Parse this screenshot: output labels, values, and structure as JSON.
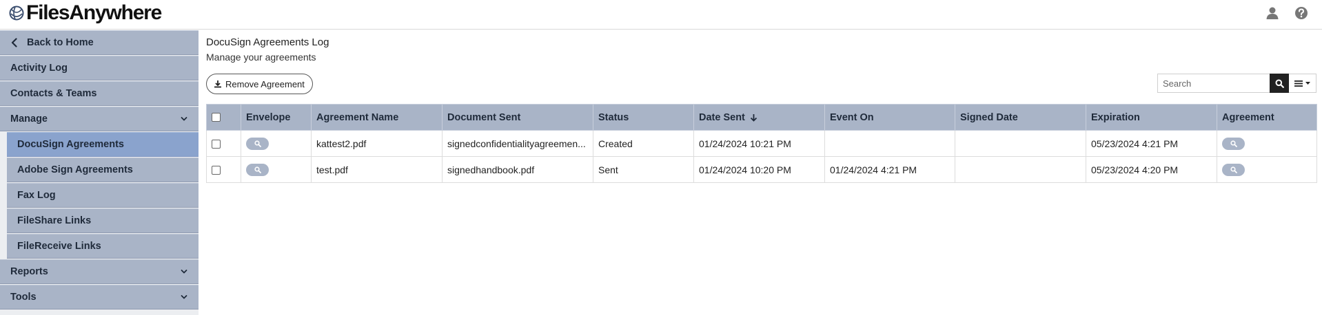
{
  "brand": {
    "name": "FilesAnywhere"
  },
  "header_icons": [
    "user-icon",
    "help-icon"
  ],
  "sidebar": {
    "items": [
      {
        "label": "Back to Home",
        "icon": "chevron-left-icon"
      },
      {
        "label": "Activity Log"
      },
      {
        "label": "Contacts & Teams"
      },
      {
        "label": "Manage",
        "icon": "chevron-down-icon"
      },
      {
        "label": "DocuSign Agreements",
        "active": true
      },
      {
        "label": "Adobe Sign Agreements"
      },
      {
        "label": "Fax Log"
      },
      {
        "label": "FileShare Links"
      },
      {
        "label": "FileReceive Links"
      },
      {
        "label": "Reports",
        "icon": "chevron-down-icon"
      },
      {
        "label": "Tools",
        "icon": "chevron-down-icon"
      }
    ]
  },
  "main": {
    "title": "DocuSign Agreements Log",
    "subtitle": "Manage your agreements",
    "remove_button": "Remove Agreement",
    "search": {
      "placeholder": "Search"
    }
  },
  "table": {
    "columns": [
      "Envelope",
      "Agreement Name",
      "Document Sent",
      "Status",
      "Date Sent",
      "Event On",
      "Signed Date",
      "Expiration",
      "Agreement"
    ],
    "sorted_column": "Date Sent",
    "rows": [
      {
        "agreement_name": "kattest2.pdf",
        "document_sent": "signedconfidentialityagreemen...",
        "status": "Created",
        "date_sent": "01/24/2024 10:21 PM",
        "event_on": "",
        "signed_date": "",
        "expiration": "05/23/2024 4:21 PM"
      },
      {
        "agreement_name": "test.pdf",
        "document_sent": "signedhandbook.pdf",
        "status": "Sent",
        "date_sent": "01/24/2024 10:20 PM",
        "event_on": "01/24/2024 4:21 PM",
        "signed_date": "",
        "expiration": "05/23/2024 4:20 PM"
      }
    ]
  },
  "colors": {
    "sidebar_item": "#a9b4c7",
    "sidebar_active": "#8aa3cd",
    "table_header": "#a9b4c7",
    "search_button": "#222222"
  }
}
